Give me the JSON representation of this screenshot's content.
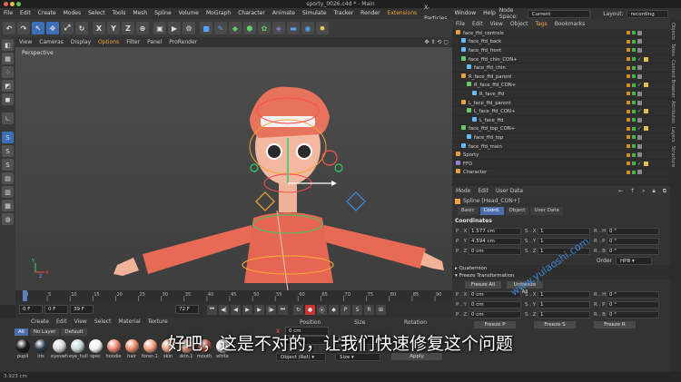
{
  "window": {
    "title": "sporty_0026.c4d * - Main"
  },
  "menubar": {
    "items": [
      "File",
      "Edit",
      "Create",
      "Modes",
      "Select",
      "Tools",
      "Mesh",
      "Spline",
      "Volume",
      "MoGraph",
      "Character",
      "Animate",
      "Simulate",
      "Tracker",
      "Render",
      "Extensions",
      "X-Particles",
      "Window",
      "Help"
    ],
    "node_space_label": "Node Space:",
    "node_space_value": "Current (Standard/Physical)",
    "layout_label": "Layout:",
    "layout_value": "recording (User)"
  },
  "toolbar": {
    "axis_x": "X",
    "axis_y": "Y",
    "axis_z": "Z"
  },
  "viewport": {
    "menu": [
      "View",
      "Cameras",
      "Display",
      "Options",
      "Filter",
      "Panel",
      "ProRender"
    ],
    "label": "Perspective"
  },
  "timeline": {
    "ticks": [
      "0",
      "5",
      "10",
      "15",
      "20",
      "25",
      "30",
      "35",
      "40",
      "45",
      "50",
      "55",
      "60",
      "65",
      "70",
      "75",
      "80",
      "85",
      "90"
    ],
    "current_frame": "0 F",
    "start_frame": "0 F",
    "preview_end": "39 F",
    "end_frame": "72 F"
  },
  "material_manager": {
    "menu": [
      "Create",
      "Edit",
      "View",
      "Select",
      "Material",
      "Texture"
    ],
    "filters": [
      "All",
      "No Layer",
      "Default"
    ],
    "materials": [
      {
        "name": "pupil",
        "color": "#1a1a1a"
      },
      {
        "name": "iris",
        "color": "#2a3a4a"
      },
      {
        "name": "eyeswh",
        "color": "#d8d8d8"
      },
      {
        "name": "eye_hull",
        "color": "#c9d7d9"
      },
      {
        "name": "spec",
        "color": "#f4f4f4"
      },
      {
        "name": "hoodie",
        "color": "#e8866f"
      },
      {
        "name": "hair",
        "color": "#e88a6a"
      },
      {
        "name": "foran.1",
        "color": "#f0a080"
      },
      {
        "name": "skin",
        "color": "#e8a082"
      },
      {
        "name": "skin.1",
        "color": "#e29a80"
      },
      {
        "name": "mouth",
        "color": "#b5504a"
      },
      {
        "name": "white",
        "color": "#ededed"
      }
    ]
  },
  "coordinates_manager": {
    "headers": [
      "Position",
      "Size",
      "Rotation"
    ],
    "x_value": "0 cm",
    "y_value": "94 cm",
    "size_y": "41.449 cm",
    "object_mode": "Object (Rel)",
    "size_mode": "Size",
    "apply": "Apply"
  },
  "status": {
    "text": "3.923 cm"
  },
  "object_manager": {
    "menu": [
      "File",
      "Edit",
      "View",
      "Object",
      "Tags",
      "Bookmarks"
    ],
    "rows": [
      {
        "name": "face_ffd_controls",
        "indent": 0,
        "icon": "#e8a040",
        "sel": false,
        "check": false
      },
      {
        "name": "face_ffd_back",
        "indent": 1,
        "icon": "#66bbff",
        "sel": false,
        "check": false
      },
      {
        "name": "face_ffd_front",
        "indent": 1,
        "icon": "#66bbff",
        "sel": false,
        "check": false
      },
      {
        "name": "face_ffd_chin_CON+",
        "indent": 1,
        "icon": "#66cc66",
        "sel": false,
        "check": true
      },
      {
        "name": "face_ffd_chin",
        "indent": 2,
        "icon": "#66bbff",
        "sel": false,
        "check": false
      },
      {
        "name": "R_face_ffd_parent",
        "indent": 1,
        "icon": "#e8a040",
        "sel": false,
        "check": false
      },
      {
        "name": "R_face_ffd_CON+",
        "indent": 2,
        "icon": "#66cc66",
        "sel": false,
        "check": true
      },
      {
        "name": "R_face_ffd",
        "indent": 3,
        "icon": "#66bbff",
        "sel": false,
        "check": false
      },
      {
        "name": "L_face_ffd_parent",
        "indent": 1,
        "icon": "#e8a040",
        "sel": false,
        "check": false
      },
      {
        "name": "L_face_ffd_CON+",
        "indent": 2,
        "icon": "#66cc66",
        "sel": false,
        "check": true
      },
      {
        "name": "L_face_ffd",
        "indent": 3,
        "icon": "#66bbff",
        "sel": false,
        "check": false
      },
      {
        "name": "face_ffd_top_CON+",
        "indent": 1,
        "icon": "#66cc66",
        "sel": false,
        "check": true
      },
      {
        "name": "face_ffd_top",
        "indent": 2,
        "icon": "#66bbff",
        "sel": false,
        "check": false
      },
      {
        "name": "face_ffd_main",
        "indent": 1,
        "icon": "#66bbff",
        "sel": false,
        "check": false
      },
      {
        "name": "Sporty",
        "indent": 0,
        "icon": "#e8a040",
        "sel": false,
        "check": false
      },
      {
        "name": "FFD",
        "indent": 0,
        "icon": "#9a7fd0",
        "sel": false,
        "check": true
      },
      {
        "name": "Character",
        "indent": 0,
        "icon": "#e8a040",
        "sel": false,
        "check": false
      }
    ]
  },
  "attribute_manager": {
    "menu": [
      "Mode",
      "Edit",
      "User Data"
    ],
    "object_name": "Spline [Head_CON+]",
    "tabs": [
      "Basic",
      "Coord.",
      "Object",
      "User Data"
    ],
    "coordinates_title": "Coordinates",
    "p_rows": [
      {
        "p": "P . X",
        "pv": "1.577 cm",
        "s": "S . X",
        "sv": "1",
        "r": "R . H",
        "rv": "0 °"
      },
      {
        "p": "P . Y",
        "pv": "4.594 cm",
        "s": "S . Y",
        "sv": "1",
        "r": "R . P",
        "rv": "0 °"
      },
      {
        "p": "P . Z",
        "pv": "0 cm",
        "s": "S . Z",
        "sv": "1",
        "r": "R . B",
        "rv": "0 °"
      }
    ],
    "order_label": "Order",
    "order_value": "HPB",
    "quaternion": "Quaternion",
    "freeze_title": "Freeze Transformation",
    "freeze_all": "Freeze All",
    "unfreeze_all": "Unfreeze All",
    "f_rows": [
      {
        "p": "P . X",
        "pv": "0 cm",
        "s": "S . X",
        "sv": "1",
        "r": "R . H",
        "rv": "0 °"
      },
      {
        "p": "P . Y",
        "pv": "0 cm",
        "s": "S . Y",
        "sv": "1",
        "r": "R . P",
        "rv": "0 °"
      },
      {
        "p": "P . Z",
        "pv": "0 cm",
        "s": "S . Z",
        "sv": "1",
        "r": "R . B",
        "rv": "0 °"
      }
    ],
    "freeze_p": "Freeze P",
    "freeze_s": "Freeze S",
    "freeze_r": "Freeze R"
  },
  "right_tabs": [
    "Objects",
    "Takes",
    "Content Browser",
    "Attributes",
    "Layers",
    "Structure"
  ],
  "subtitle": "好吧，这是不对的，让我们快速修复这个问题",
  "watermark": "www.yulaoshi.com"
}
